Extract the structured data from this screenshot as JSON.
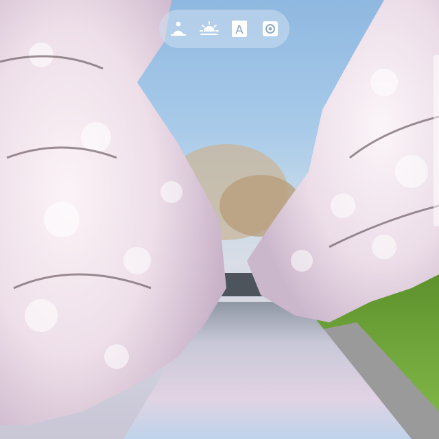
{
  "toolbar": {
    "tools": [
      {
        "icon": "person-meditation-icon"
      },
      {
        "icon": "sunrise-icon"
      },
      {
        "icon": "letter-a-icon",
        "glyph": "A"
      },
      {
        "icon": "circle-target-icon"
      }
    ]
  },
  "scene": {
    "subject": "photo",
    "colors": {
      "sky": "#9fc3e6",
      "blossom": "#f3e6ee",
      "blossom_shade": "#d9c5d8",
      "water": "#b9c8dc",
      "grass": "#6fa33a",
      "wall": "#8f8f8f"
    }
  }
}
